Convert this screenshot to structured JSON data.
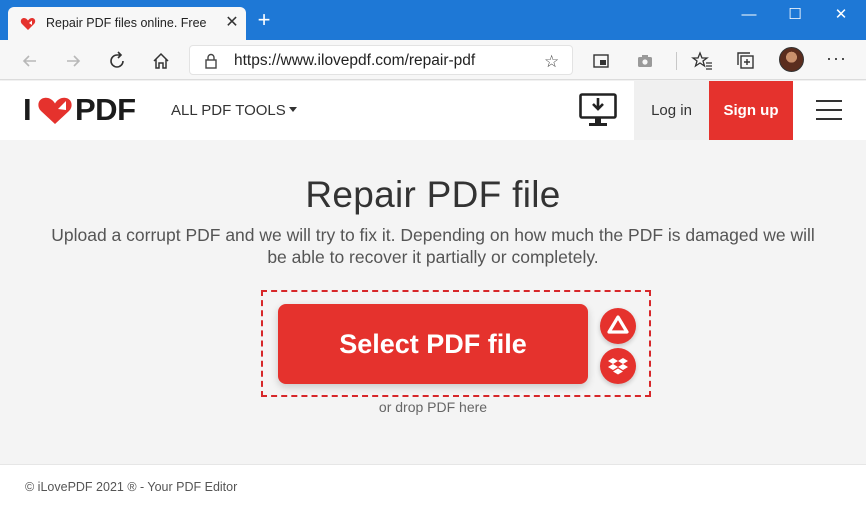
{
  "browser": {
    "tab_title": "Repair PDF files online. Free tool",
    "tab_close": "✕",
    "new_tab": "+",
    "url": "https://www.ilovepdf.com/repair-pdf",
    "window_controls": {
      "minimize": "—",
      "maximize": "☐",
      "close": "✕"
    },
    "favorites_star": "☆",
    "more_menu": "···"
  },
  "header": {
    "logo": {
      "i": "I",
      "pdf": "PDF"
    },
    "tools_menu": "ALL PDF TOOLS",
    "login": "Log in",
    "signup": "Sign up"
  },
  "main": {
    "title": "Repair PDF file",
    "description": "Upload a corrupt PDF and we will try to fix it. Depending on how much the PDF is damaged we will be able to recover it partially or completely.",
    "select_button": "Select PDF file",
    "drop_hint": "or drop PDF here"
  },
  "footer": {
    "copyright": "© iLovePDF 2021 ® - Your PDF Editor"
  },
  "colors": {
    "brand_red": "#e5322d",
    "titlebar_blue": "#1e78d6",
    "page_bg": "#f4f4f4"
  },
  "icons": [
    "heart-favicon-icon",
    "back-icon",
    "forward-icon",
    "refresh-icon",
    "home-icon",
    "lock-icon",
    "star-icon",
    "pip-icon",
    "camera-icon",
    "favorites-icon",
    "collections-icon",
    "desktop-download-icon",
    "google-drive-icon",
    "dropbox-icon",
    "hamburger-icon"
  ]
}
